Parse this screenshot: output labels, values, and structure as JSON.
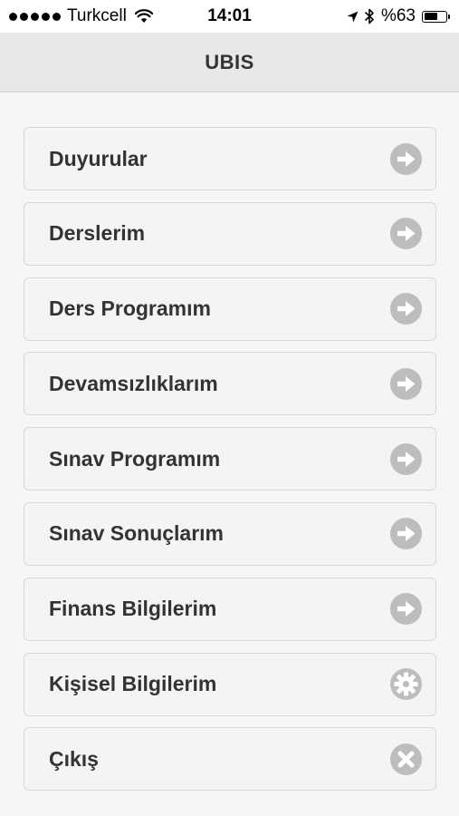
{
  "status_bar": {
    "carrier": "Turkcell",
    "time": "14:01",
    "battery_text": "%63",
    "battery_level": 0.63,
    "signal_bars": 5
  },
  "nav": {
    "title": "UBIS"
  },
  "menu": {
    "items": [
      {
        "label": "Duyurular",
        "icon": "arrow-right-icon"
      },
      {
        "label": "Derslerim",
        "icon": "arrow-right-icon"
      },
      {
        "label": "Ders Programım",
        "icon": "arrow-right-icon"
      },
      {
        "label": "Devamsızlıklarım",
        "icon": "arrow-right-icon"
      },
      {
        "label": "Sınav Programım",
        "icon": "arrow-right-icon"
      },
      {
        "label": "Sınav Sonuçlarım",
        "icon": "arrow-right-icon"
      },
      {
        "label": "Finans Bilgilerim",
        "icon": "arrow-right-icon"
      },
      {
        "label": "Kişisel Bilgilerim",
        "icon": "gear-icon"
      },
      {
        "label": "Çıkış",
        "icon": "close-icon"
      }
    ]
  },
  "colors": {
    "icon_gray": "#bdbdbd",
    "text": "#333333",
    "nav_bg": "#e8e8e8",
    "page_bg": "#f6f6f6"
  }
}
